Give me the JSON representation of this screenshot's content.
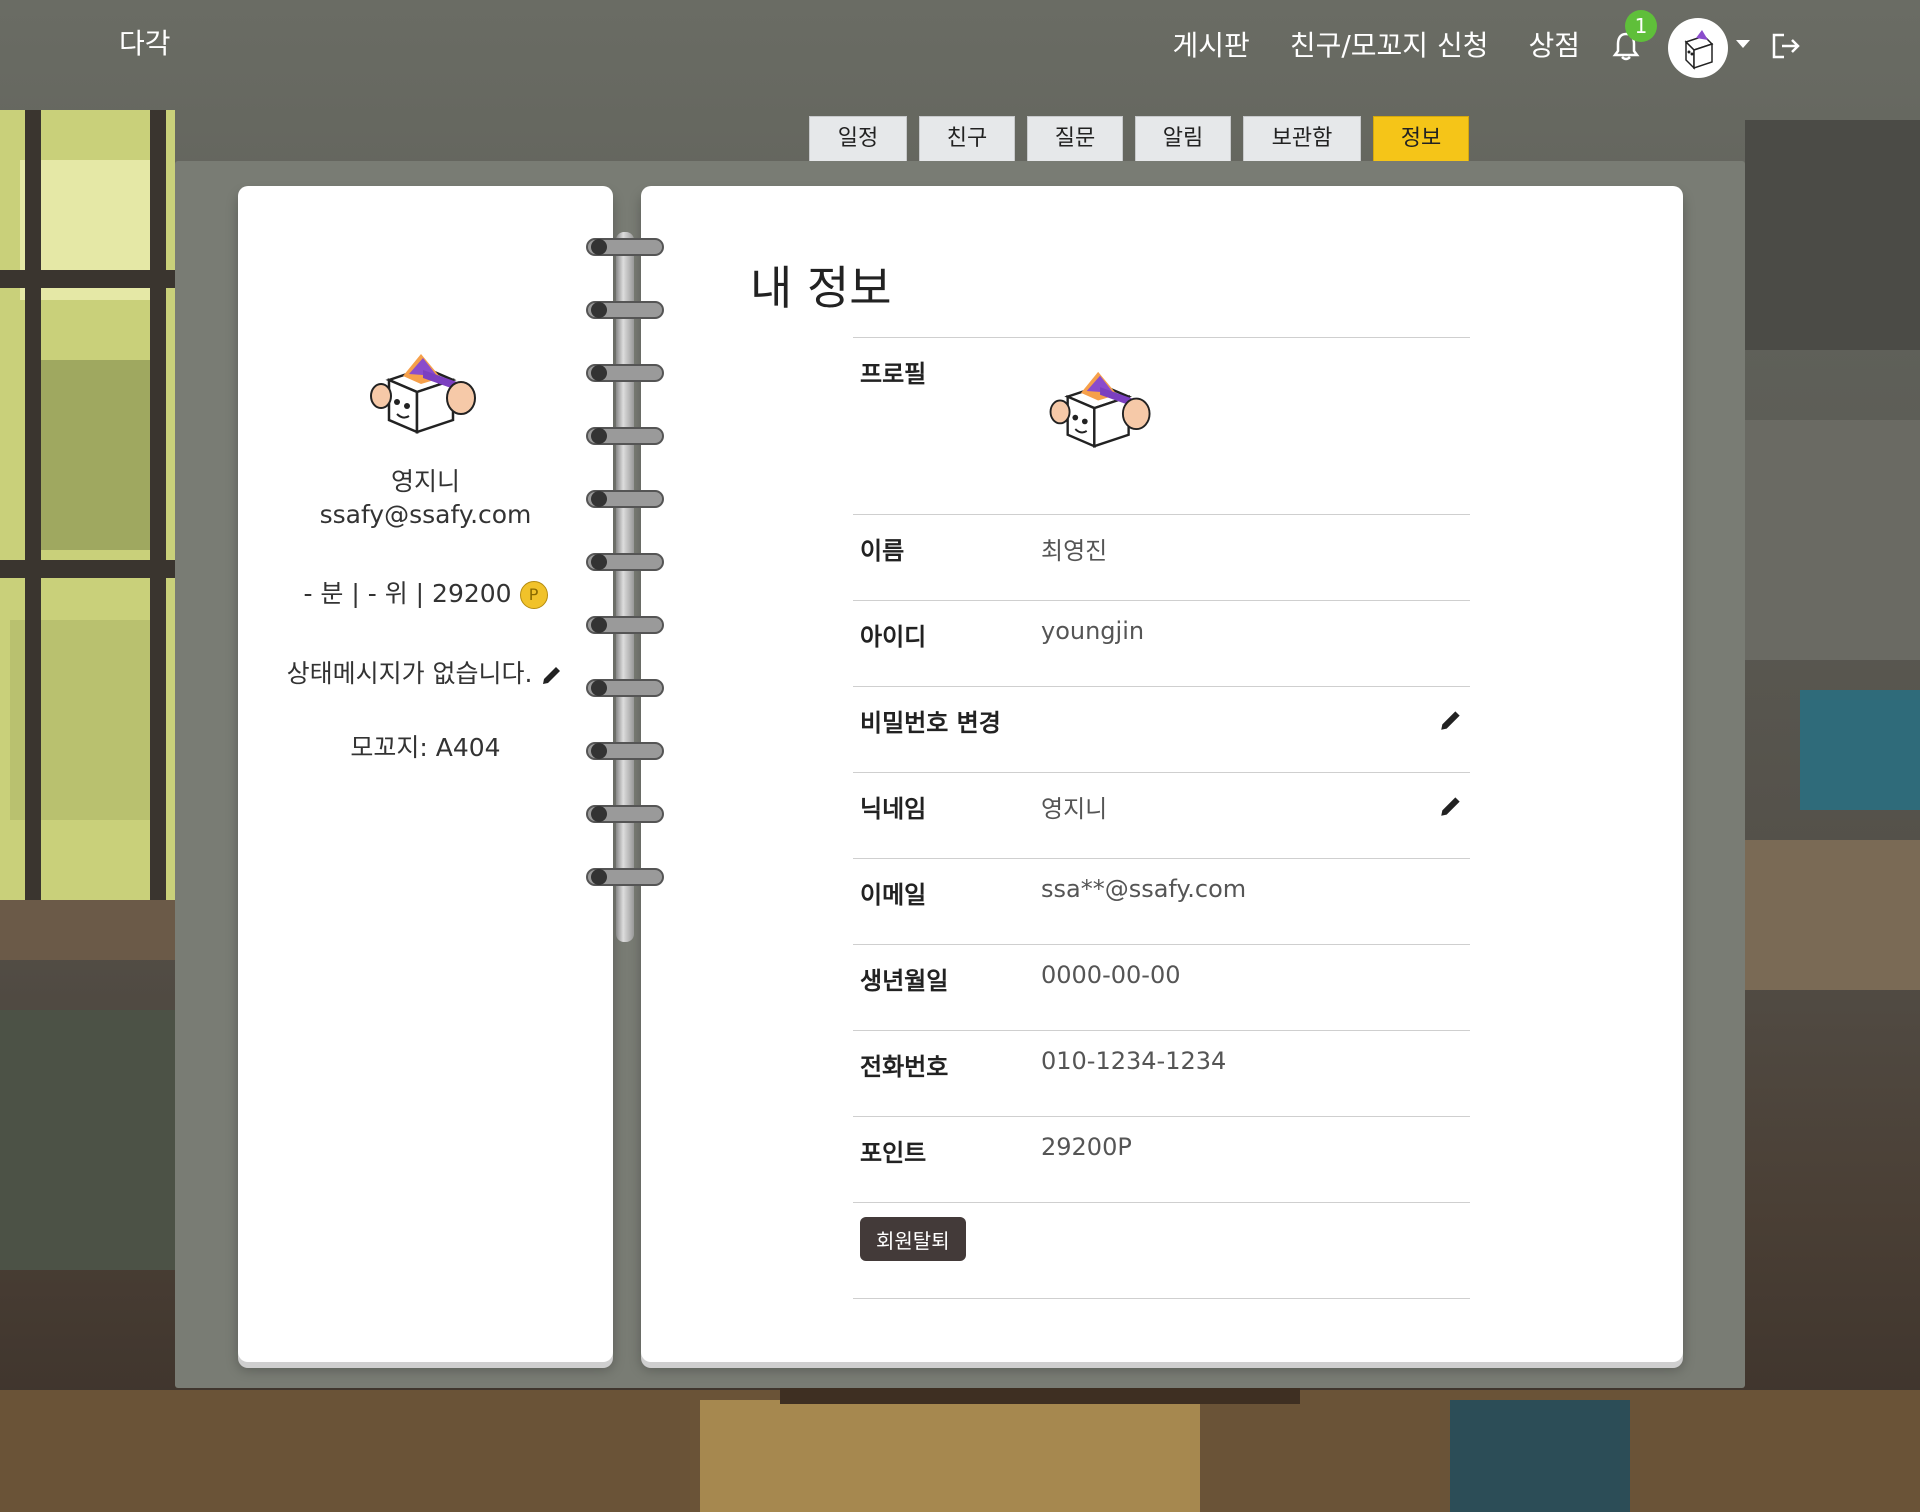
{
  "nav": {
    "brand": "다각",
    "links": [
      "게시판",
      "친구/모꼬지 신청",
      "상점"
    ],
    "notification_count": "1",
    "icons": [
      "bell-icon",
      "avatar",
      "chevron-down-icon",
      "logout-icon"
    ]
  },
  "tabs": [
    {
      "label": "일정",
      "active": false
    },
    {
      "label": "친구",
      "active": false
    },
    {
      "label": "질문",
      "active": false
    },
    {
      "label": "알림",
      "active": false
    },
    {
      "label": "보관함",
      "active": false
    },
    {
      "label": "정보",
      "active": true
    }
  ],
  "left_page": {
    "nickname": "영지니",
    "email": "ssafy@ssafy.com",
    "stats": "- 분 |  - 위 | 29200",
    "coin_symbol": "P",
    "status_message": "상태메시지가 없습니다.",
    "mokkoji": "모꼬지: A404"
  },
  "right_page": {
    "title": "내 정보",
    "rows": {
      "profile_label": "프로필",
      "name_label": "이름",
      "name_value": "최영진",
      "id_label": "아이디",
      "id_value": "youngjin",
      "password_label": "비밀번호 변경",
      "nickname_label": "닉네임",
      "nickname_value": "영지니",
      "email_label": "이메일",
      "email_value": "ssa**@ssafy.com",
      "birth_label": "생년월일",
      "birth_value": "0000-00-00",
      "phone_label": "전화번호",
      "phone_value": "010-1234-1234",
      "point_label": "포인트",
      "point_value": "29200P"
    },
    "withdraw_label": "회원탈퇴"
  },
  "colors": {
    "active_tab": "#f5c518",
    "badge": "#5fbf3a",
    "board": "#797c74",
    "withdraw_button": "#433a39"
  }
}
